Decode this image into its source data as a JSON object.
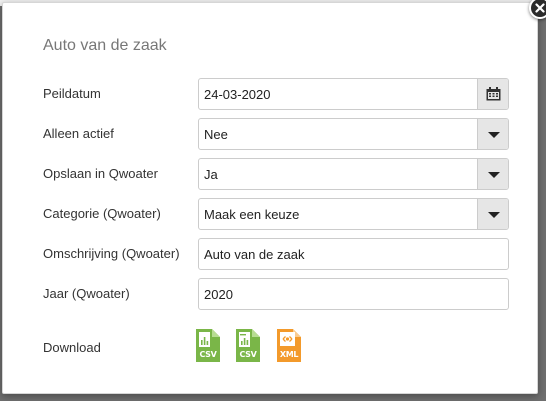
{
  "dialog": {
    "title": "Auto van de zaak"
  },
  "fields": {
    "peildatum": {
      "label": "Peildatum",
      "value": "24-03-2020",
      "icon": "calendar-icon"
    },
    "alleen_actief": {
      "label": "Alleen actief",
      "value": "Nee",
      "icon": "chevron-down-icon"
    },
    "opslaan": {
      "label": "Opslaan in Qwoater",
      "value": "Ja",
      "icon": "chevron-down-icon"
    },
    "categorie": {
      "label": "Categorie (Qwoater)",
      "value": "Maak een keuze",
      "icon": "chevron-down-icon"
    },
    "omschrijving": {
      "label": "Omschrijving (Qwoater)",
      "value": "Auto van de zaak"
    },
    "jaar": {
      "label": "Jaar (Qwoater)",
      "value": "2020"
    }
  },
  "download": {
    "label": "Download",
    "files": [
      {
        "name": "csv-file-icon",
        "text": "CSV",
        "color": "#7ab648"
      },
      {
        "name": "csv-excel-file-icon",
        "text": "CSV",
        "color": "#7ab648"
      },
      {
        "name": "xml-file-icon",
        "text": "XML",
        "color": "#f39a2b"
      }
    ]
  },
  "colors": {
    "addon_background": "#e6e6e6",
    "border": "#cccccc",
    "close_button": "#2b2b2b"
  }
}
